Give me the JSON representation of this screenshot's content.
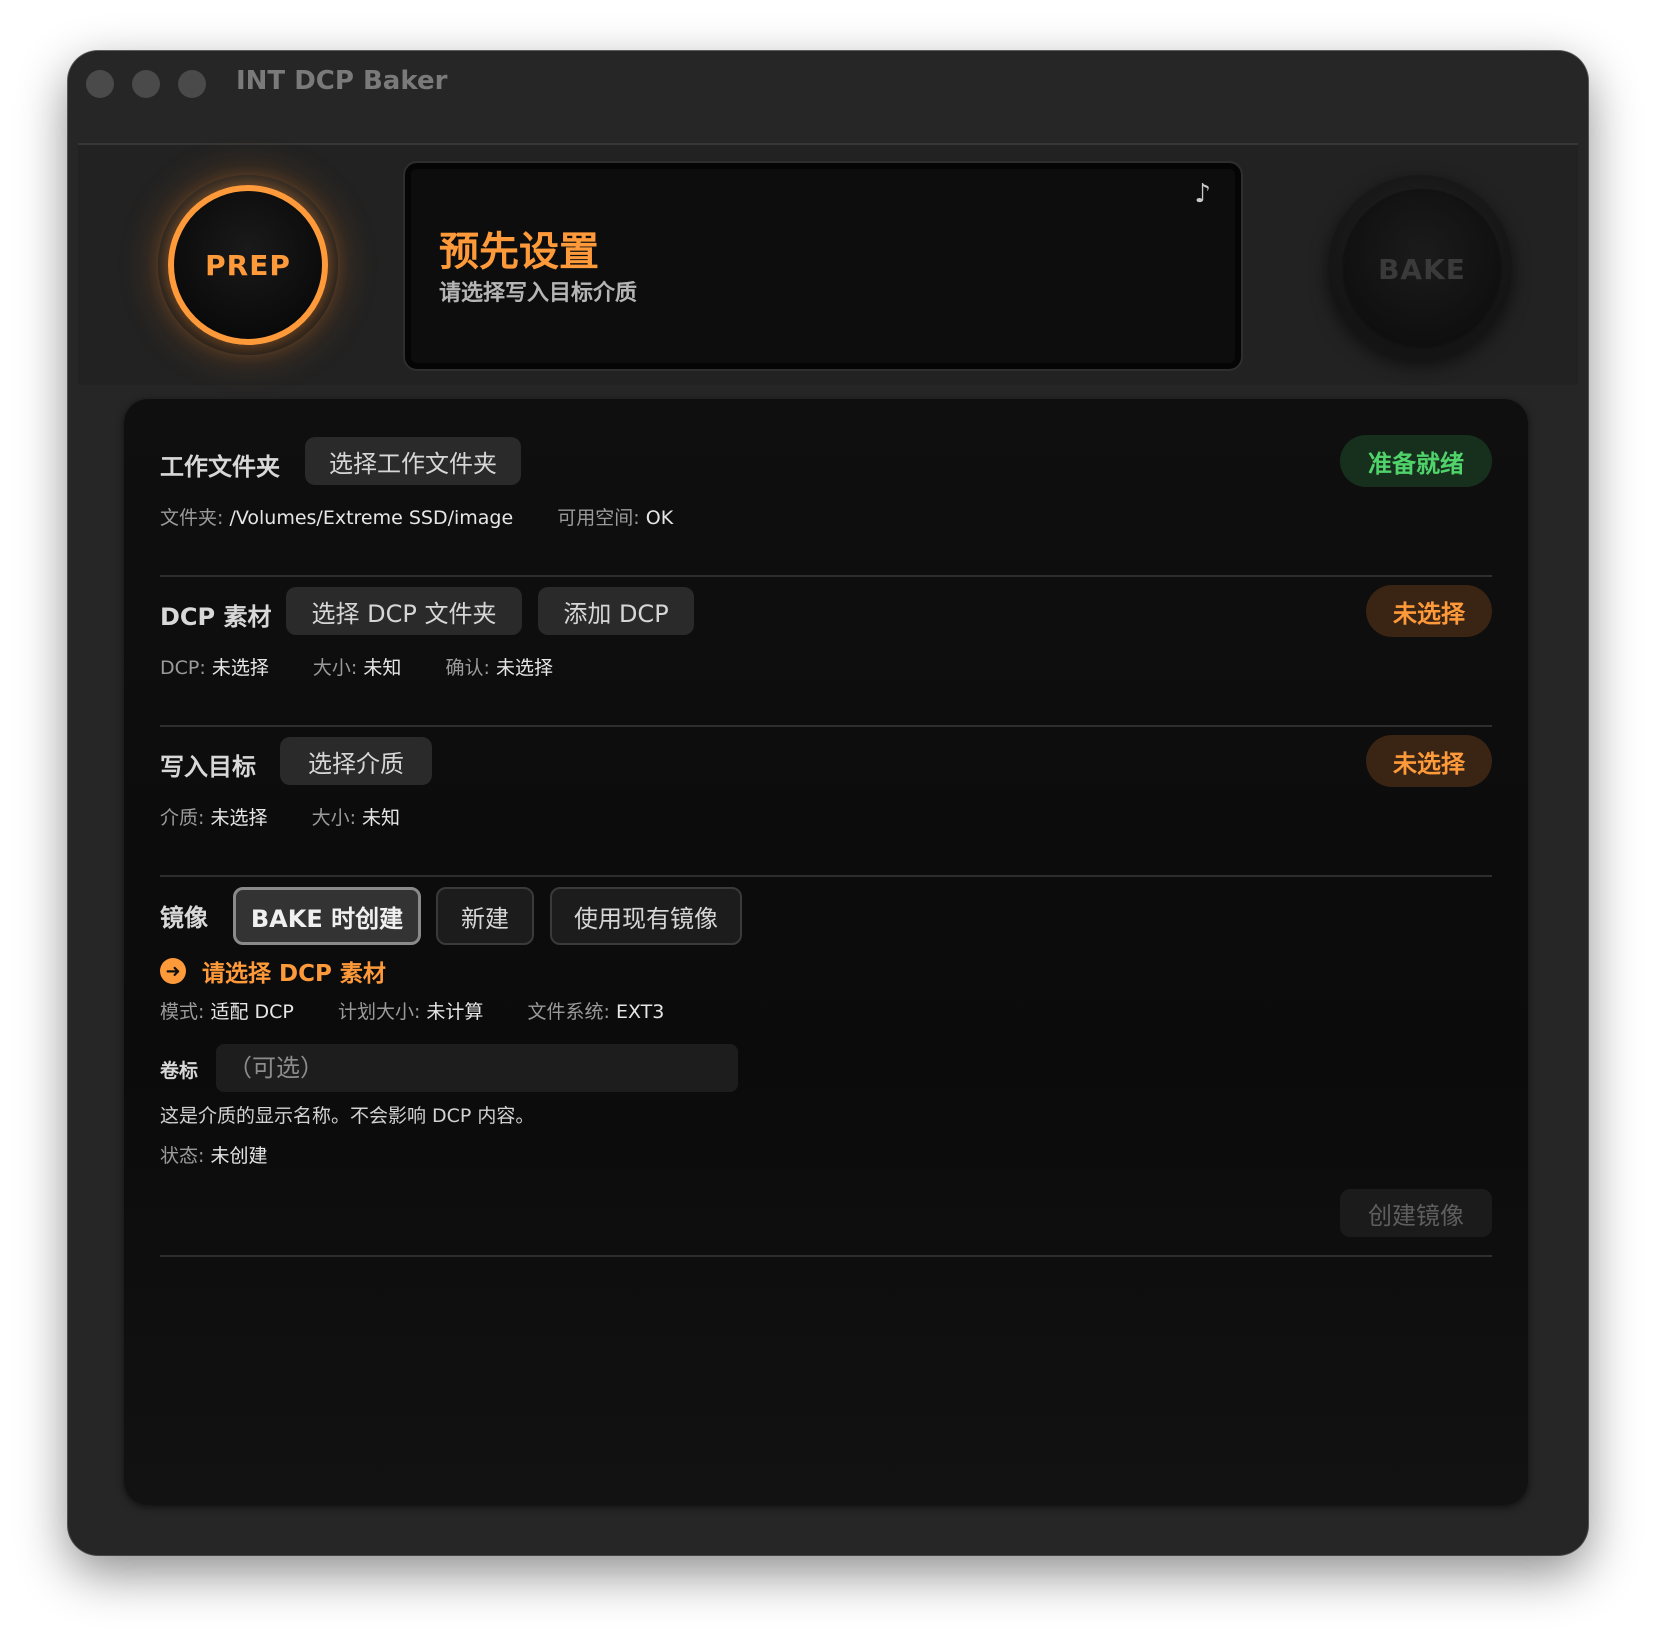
{
  "window": {
    "title": "INT DCP Baker"
  },
  "hero": {
    "prep_label": "PREP",
    "bake_label": "BAKE",
    "display_title": "预先设置",
    "display_subtitle": "请选择写入目标介质",
    "music_icon": "music-note-icon",
    "accent_color": "#ff9a3a"
  },
  "work_folder": {
    "title": "工作文件夹",
    "choose_button": "选择工作文件夹",
    "status": "准备就绪",
    "folder_key": "文件夹:",
    "folder_value": "/Volumes/Extreme SSD/image",
    "space_key": "可用空间:",
    "space_value": "OK"
  },
  "dcp": {
    "title": "DCP 素材",
    "choose_folder_button": "选择 DCP 文件夹",
    "add_button": "添加 DCP",
    "status": "未选择",
    "dcp_key": "DCP:",
    "dcp_value": "未选择",
    "size_key": "大小:",
    "size_value": "未知",
    "confirm_key": "确认:",
    "confirm_value": "未选择"
  },
  "target": {
    "title": "写入目标",
    "choose_button": "选择介质",
    "status": "未选择",
    "media_key": "介质:",
    "media_value": "未选择",
    "size_key": "大小:",
    "size_value": "未知"
  },
  "image": {
    "title": "镜像",
    "options": [
      "BAKE 时创建",
      "新建",
      "使用现有镜像"
    ],
    "selected_option": "BAKE 时创建",
    "warning_icon": "arrow-right-circle-icon",
    "warning_text": "请选择 DCP 素材",
    "mode_key": "模式:",
    "mode_value": "适配 DCP",
    "plan_size_key": "计划大小:",
    "plan_size_value": "未计算",
    "fs_key": "文件系统:",
    "fs_value": "EXT3",
    "volume_label": "卷标",
    "volume_placeholder": "（可选）",
    "volume_value": "",
    "note": "这是介质的显示名称。不会影响 DCP 内容。",
    "state_key": "状态:",
    "state_value": "未创建",
    "create_button": "创建镜像"
  },
  "colors": {
    "ready_green": "#4fd36a",
    "warn_orange": "#ff9a3a"
  }
}
